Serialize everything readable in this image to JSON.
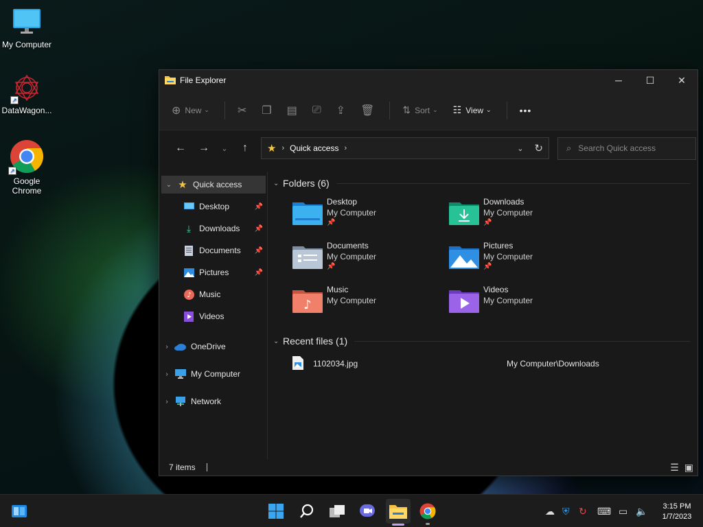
{
  "desktop": {
    "icons": [
      {
        "label": "My Computer"
      },
      {
        "label": "DataWagon..."
      },
      {
        "label": "Google Chrome"
      }
    ]
  },
  "window": {
    "title": "File Explorer"
  },
  "toolbar": {
    "new_label": "New",
    "sort_label": "Sort",
    "view_label": "View",
    "more_label": "•••"
  },
  "address": {
    "location": "Quick access",
    "search_placeholder": "Search Quick access"
  },
  "nav_pane": {
    "quick_access": "Quick access",
    "pinned": [
      "Desktop",
      "Downloads",
      "Documents",
      "Pictures"
    ],
    "unpinned": [
      "Music",
      "Videos"
    ],
    "onedrive": "OneDrive",
    "my_computer": "My Computer",
    "network": "Network"
  },
  "folders_section": {
    "title": "Folders (6)",
    "items": [
      {
        "name": "Desktop",
        "location": "My Computer",
        "pinned": true
      },
      {
        "name": "Downloads",
        "location": "My Computer",
        "pinned": true
      },
      {
        "name": "Documents",
        "location": "My Computer",
        "pinned": true
      },
      {
        "name": "Pictures",
        "location": "My Computer",
        "pinned": true
      },
      {
        "name": "Music",
        "location": "My Computer",
        "pinned": false
      },
      {
        "name": "Videos",
        "location": "My Computer",
        "pinned": false
      }
    ]
  },
  "recent_section": {
    "title": "Recent files (1)",
    "files": [
      {
        "name": "1102034.jpg",
        "path": "My Computer\\Downloads"
      }
    ]
  },
  "status_bar": {
    "items_count": "7 items"
  },
  "taskbar": {
    "time": "3:15 PM",
    "date": "1/7/2023"
  },
  "colors": {
    "accent": "#4cc2ff",
    "folder_yellow": "#f5c542",
    "window_bg": "#191919"
  }
}
